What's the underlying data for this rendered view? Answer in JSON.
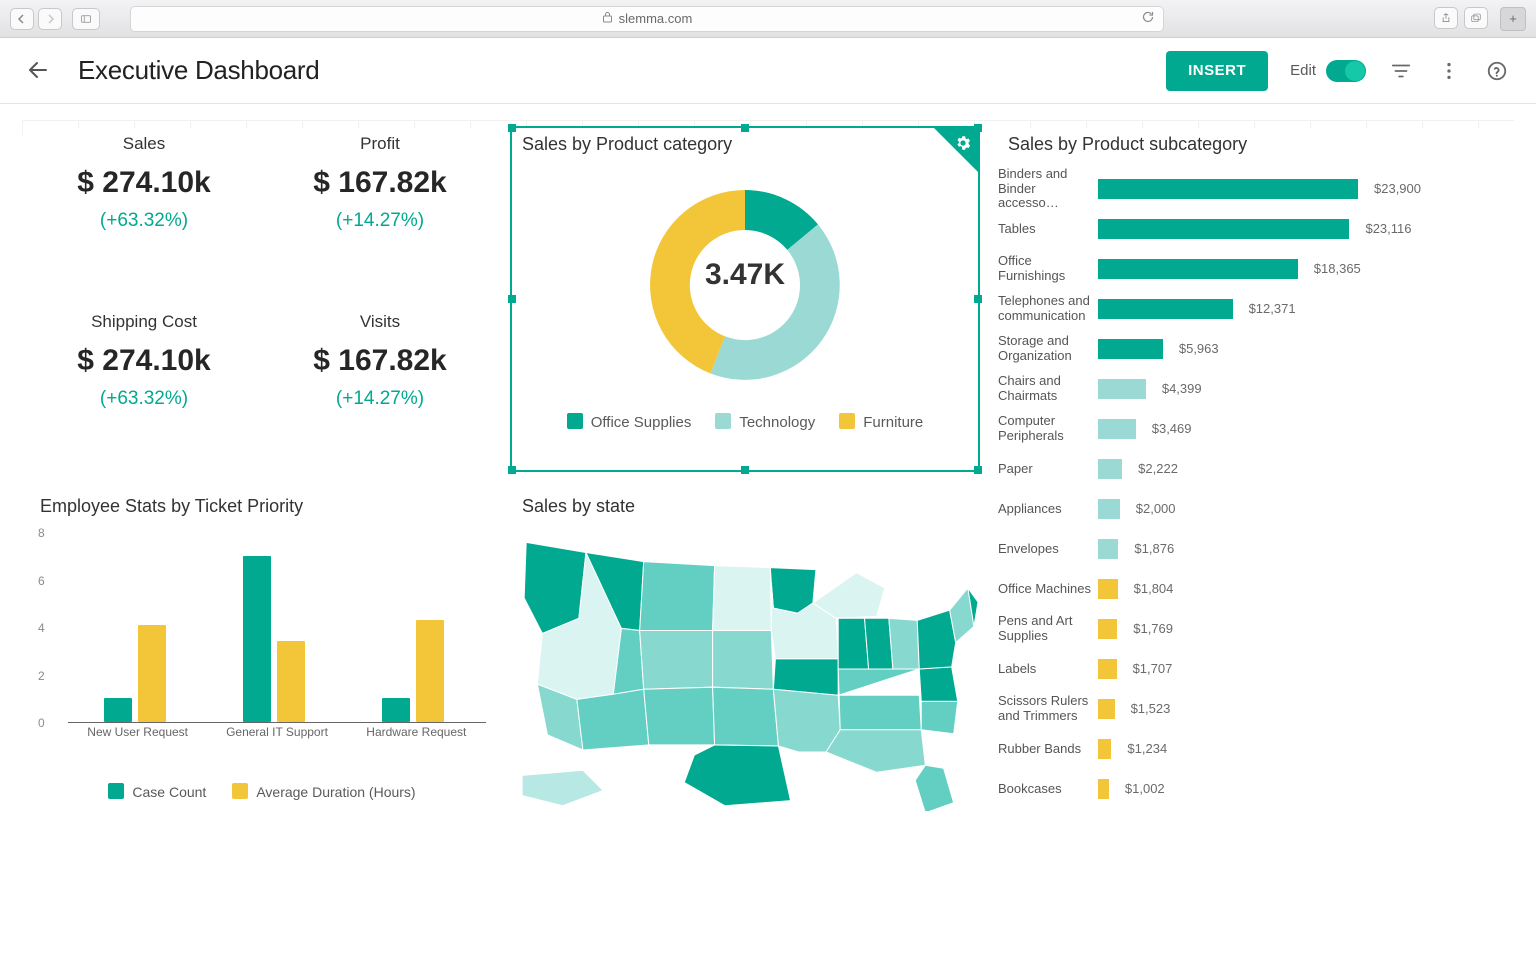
{
  "browser": {
    "url": "slemma.com"
  },
  "toolbar": {
    "title": "Executive Dashboard",
    "insert_label": "INSERT",
    "edit_label": "Edit"
  },
  "kpis": [
    {
      "title": "Sales",
      "value": "$ 274.10k",
      "delta": "(+63.32%)"
    },
    {
      "title": "Profit",
      "value": "$ 167.82k",
      "delta": "(+14.27%)"
    },
    {
      "title": "Shipping Cost",
      "value": "$ 274.10k",
      "delta": "(+63.32%)"
    },
    {
      "title": "Visits",
      "value": "$ 167.82k",
      "delta": "(+14.27%)"
    }
  ],
  "donut": {
    "title": "Sales by Product category",
    "center": "3.47K",
    "legend": [
      "Office Supplies",
      "Technology",
      "Furniture"
    ]
  },
  "employee_stats": {
    "title": "Employee Stats by Ticket Priority",
    "legend": [
      "Case Count",
      "Average Duration (Hours)"
    ],
    "y_ticks": [
      "0",
      "2",
      "4",
      "6",
      "8"
    ],
    "categories": [
      "New User Request",
      "General IT Support",
      "Hardware Request"
    ]
  },
  "map": {
    "title": "Sales by state"
  },
  "subcat": {
    "title": "Sales by Product subcategory",
    "rows": [
      {
        "label": "Binders and Binder accesso…",
        "value": "$23,900"
      },
      {
        "label": "Tables",
        "value": "$23,116"
      },
      {
        "label": "Office Furnishings",
        "value": "$18,365"
      },
      {
        "label": "Telephones and communication",
        "value": "$12,371"
      },
      {
        "label": "Storage and Organization",
        "value": "$5,963"
      },
      {
        "label": "Chairs and Chairmats",
        "value": "$4,399"
      },
      {
        "label": "Computer Peripherals",
        "value": "$3,469"
      },
      {
        "label": "Paper",
        "value": "$2,222"
      },
      {
        "label": "Appliances",
        "value": "$2,000"
      },
      {
        "label": "Envelopes",
        "value": "$1,876"
      },
      {
        "label": "Office Machines",
        "value": "$1,804"
      },
      {
        "label": "Pens and Art Supplies",
        "value": "$1,769"
      },
      {
        "label": "Labels",
        "value": "$1,707"
      },
      {
        "label": "Scissors Rulers and Trimmers",
        "value": "$1,523"
      },
      {
        "label": "Rubber Bands",
        "value": "$1,234"
      },
      {
        "label": "Bookcases",
        "value": "$1,002"
      }
    ]
  },
  "colors": {
    "teal": "#00a98f",
    "teal_light": "#9ad9d4",
    "yellow": "#f3c63a"
  },
  "chart_data": [
    {
      "type": "pie",
      "title": "Sales by Product category",
      "series": [
        {
          "name": "Office Supplies",
          "value_pct": 14,
          "color": "#00a98f"
        },
        {
          "name": "Technology",
          "value_pct": 44,
          "color": "#9ad9d4"
        },
        {
          "name": "Furniture",
          "value_pct": 42,
          "color": "#f3c63a"
        }
      ],
      "center_label": "3.47K"
    },
    {
      "type": "bar",
      "title": "Employee Stats by Ticket Priority",
      "categories": [
        "New User Request",
        "General IT Support",
        "Hardware Request"
      ],
      "series": [
        {
          "name": "Case Count",
          "values": [
            1.0,
            7.0,
            1.0
          ],
          "color": "#00a98f"
        },
        {
          "name": "Average Duration (Hours)",
          "values": [
            4.1,
            3.4,
            4.3
          ],
          "color": "#f3c63a"
        }
      ],
      "ylim": [
        0,
        8
      ],
      "ylabel": "",
      "xlabel": ""
    },
    {
      "type": "bar",
      "title": "Sales by Product subcategory",
      "orientation": "horizontal",
      "categories": [
        "Binders and Binder accessories",
        "Tables",
        "Office Furnishings",
        "Telephones and communication",
        "Storage and Organization",
        "Chairs and Chairmats",
        "Computer Peripherals",
        "Paper",
        "Appliances",
        "Envelopes",
        "Office Machines",
        "Pens and Art Supplies",
        "Labels",
        "Scissors Rulers and Trimmers",
        "Rubber Bands",
        "Bookcases"
      ],
      "values": [
        23900,
        23116,
        18365,
        12371,
        5963,
        4399,
        3469,
        2222,
        2000,
        1876,
        1804,
        1769,
        1707,
        1523,
        1234,
        1002
      ],
      "colors": [
        "#00a98f",
        "#00a98f",
        "#00a98f",
        "#00a98f",
        "#00a98f",
        "#9ad9d4",
        "#9ad9d4",
        "#9ad9d4",
        "#9ad9d4",
        "#9ad9d4",
        "#f3c63a",
        "#f3c63a",
        "#f3c63a",
        "#f3c63a",
        "#f3c63a",
        "#f3c63a"
      ]
    }
  ]
}
